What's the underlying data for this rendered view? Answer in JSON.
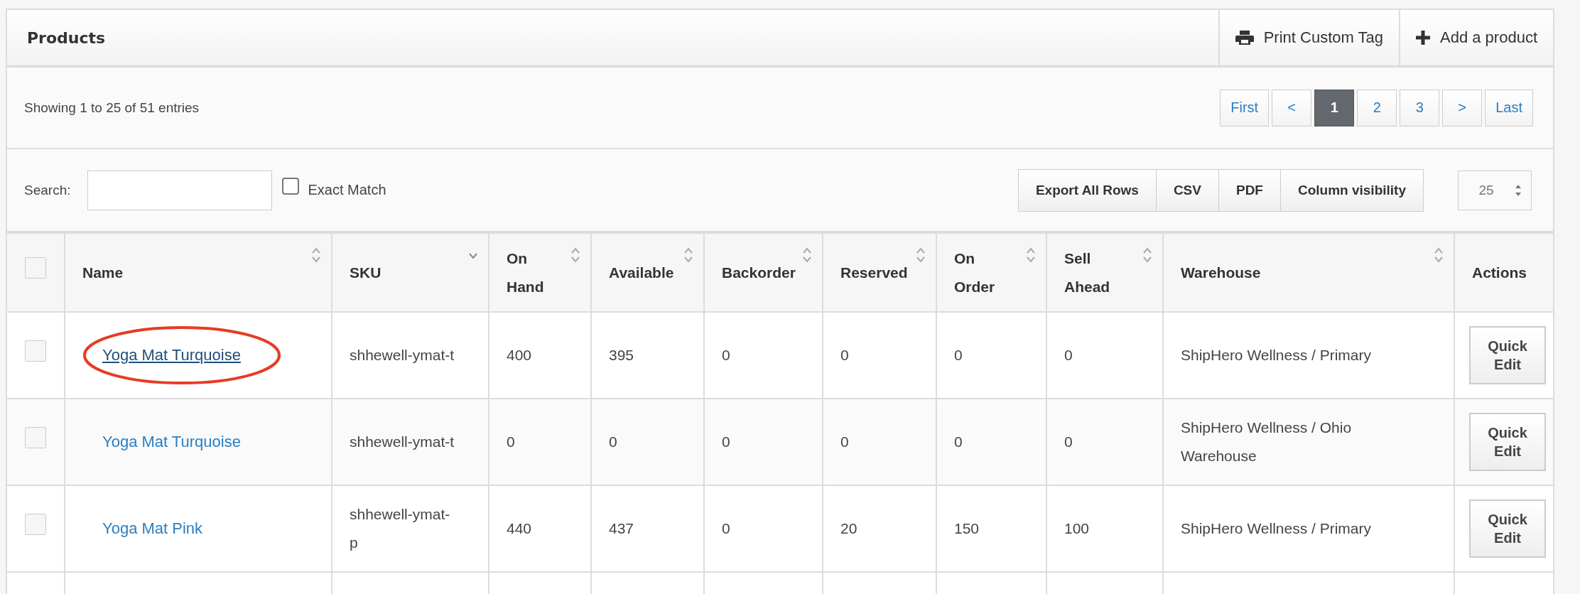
{
  "panel": {
    "title": "Products",
    "actions": [
      {
        "kind": "print",
        "label": "Print Custom Tag"
      },
      {
        "kind": "add",
        "label": "Add a product"
      }
    ]
  },
  "info": "Showing 1 to 25 of 51 entries",
  "pagination": [
    {
      "label": "First",
      "selected": false
    },
    {
      "label": "<",
      "selected": false
    },
    {
      "label": "1",
      "selected": true
    },
    {
      "label": "2",
      "selected": false
    },
    {
      "label": "3",
      "selected": false
    },
    {
      "label": ">",
      "selected": false
    },
    {
      "label": "Last",
      "selected": false
    }
  ],
  "search": {
    "label": "Search:"
  },
  "exact_match": {
    "label": "Exact Match",
    "checked": false
  },
  "export_buttons": [
    "Export All Rows",
    "CSV",
    "PDF",
    "Column visibility"
  ],
  "page_size": "25",
  "table": {
    "select_all": false,
    "columns": [
      {
        "label": "Name",
        "sortable": true,
        "sorted": false
      },
      {
        "label": "SKU",
        "sortable": true,
        "sorted": true
      },
      {
        "label": "On Hand",
        "sortable": true,
        "sorted": false
      },
      {
        "label": "Available",
        "sortable": true,
        "sorted": false
      },
      {
        "label": "Backorder",
        "sortable": true,
        "sorted": false
      },
      {
        "label": "Reserved",
        "sortable": true,
        "sorted": false
      },
      {
        "label": "On Order",
        "sortable": true,
        "sorted": false
      },
      {
        "label": "Sell Ahead",
        "sortable": true,
        "sorted": false
      },
      {
        "label": "Warehouse",
        "sortable": true,
        "sorted": false
      },
      {
        "label": "Actions",
        "sortable": false
      }
    ],
    "rows": [
      {
        "checked": false,
        "highlighted": true,
        "cells": [
          "Yoga Mat Turquoise",
          "shhewell-ymat-t",
          "400",
          "395",
          "0",
          "0",
          "0",
          "0",
          "ShipHero Wellness / Primary",
          "Quick Edit"
        ]
      },
      {
        "checked": false,
        "highlighted": false,
        "cells": [
          "Yoga Mat Turquoise",
          "shhewell-ymat-t",
          "0",
          "0",
          "0",
          "0",
          "0",
          "0",
          "ShipHero Wellness / Ohio Warehouse",
          "Quick Edit"
        ]
      },
      {
        "checked": false,
        "highlighted": false,
        "cells": [
          "Yoga Mat Pink",
          "shhewell-ymat-p",
          "440",
          "437",
          "0",
          "20",
          "150",
          "100",
          "ShipHero Wellness / Primary",
          "Quick Edit"
        ]
      }
    ]
  }
}
